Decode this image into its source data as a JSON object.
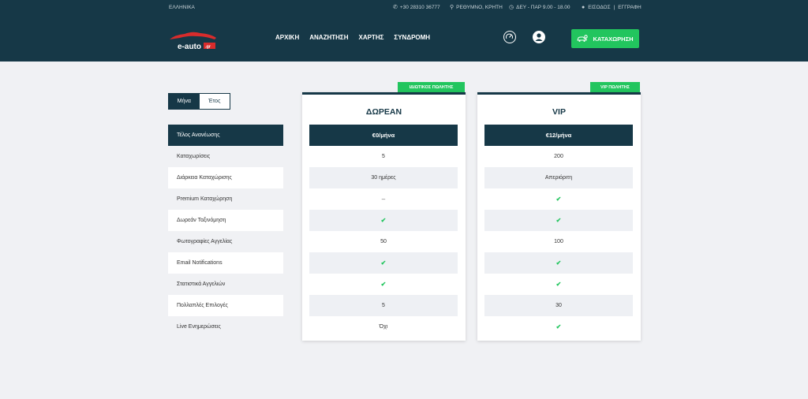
{
  "topbar": {
    "language": "ΕΛΛΗΝΙΚΑ",
    "phone": "+30 28310 36777",
    "location": "ΡΕΘΥΜΝΟ, ΚΡΗΤΗ",
    "hours": "ΔΕΥ - ΠΑΡ 9.00 - 18.00",
    "login": "ΕΙΣΟΔΟΣ",
    "separator": "|",
    "register": "ΕΓΓΡΑΦΗ"
  },
  "logo": {
    "text": "e-auto",
    "suffix": ".gr"
  },
  "nav": [
    "ΑΡΧΙΚΗ",
    "ΑΝΑΖΗΤΗΣΗ",
    "ΧΑΡΤΗΣ",
    "ΣΥΝΔΡΟΜΗ"
  ],
  "cta": {
    "label": "ΚΑΤΑΧΩΡΗΣΗ"
  },
  "toggle": {
    "month": "Μήνα",
    "year": "Έτος",
    "selected": "month"
  },
  "features": {
    "header": "Τέλος Ανανέωσης",
    "items": [
      "Καταχωρίσεις",
      "Διάρκεια Καταχώρισης",
      "Premium Καταχώρηση",
      "Δωρεάν Ταξινόμηση",
      "Φωτογραφίες Αγγελίας",
      "Email Notifications",
      "Στατιστικά Αγγελιών",
      "Πολλαπλές Επιλογές",
      "Live Ενημερώσεις"
    ]
  },
  "plans": [
    {
      "badge": "ΙΔΙΩΤΙΚΟΣ ΠΩΛΗΤΗΣ",
      "name": "ΔΩΡΕΑΝ",
      "price": "€0/μήνα",
      "values": [
        "5",
        "30 ημέρες",
        "–",
        "✔",
        "50",
        "✔",
        "✔",
        "5",
        "Όχι"
      ]
    },
    {
      "badge": "VIP ΠΩΛΗΤΗΣ",
      "name": "VIP",
      "price": "€12/μήνα",
      "values": [
        "200",
        "Απεριόριτη",
        "✔",
        "✔",
        "100",
        "✔",
        "✔",
        "30",
        "✔"
      ]
    }
  ],
  "colors": {
    "navy": "#163847",
    "green": "#22c55e",
    "background": "#f0f1f4"
  }
}
